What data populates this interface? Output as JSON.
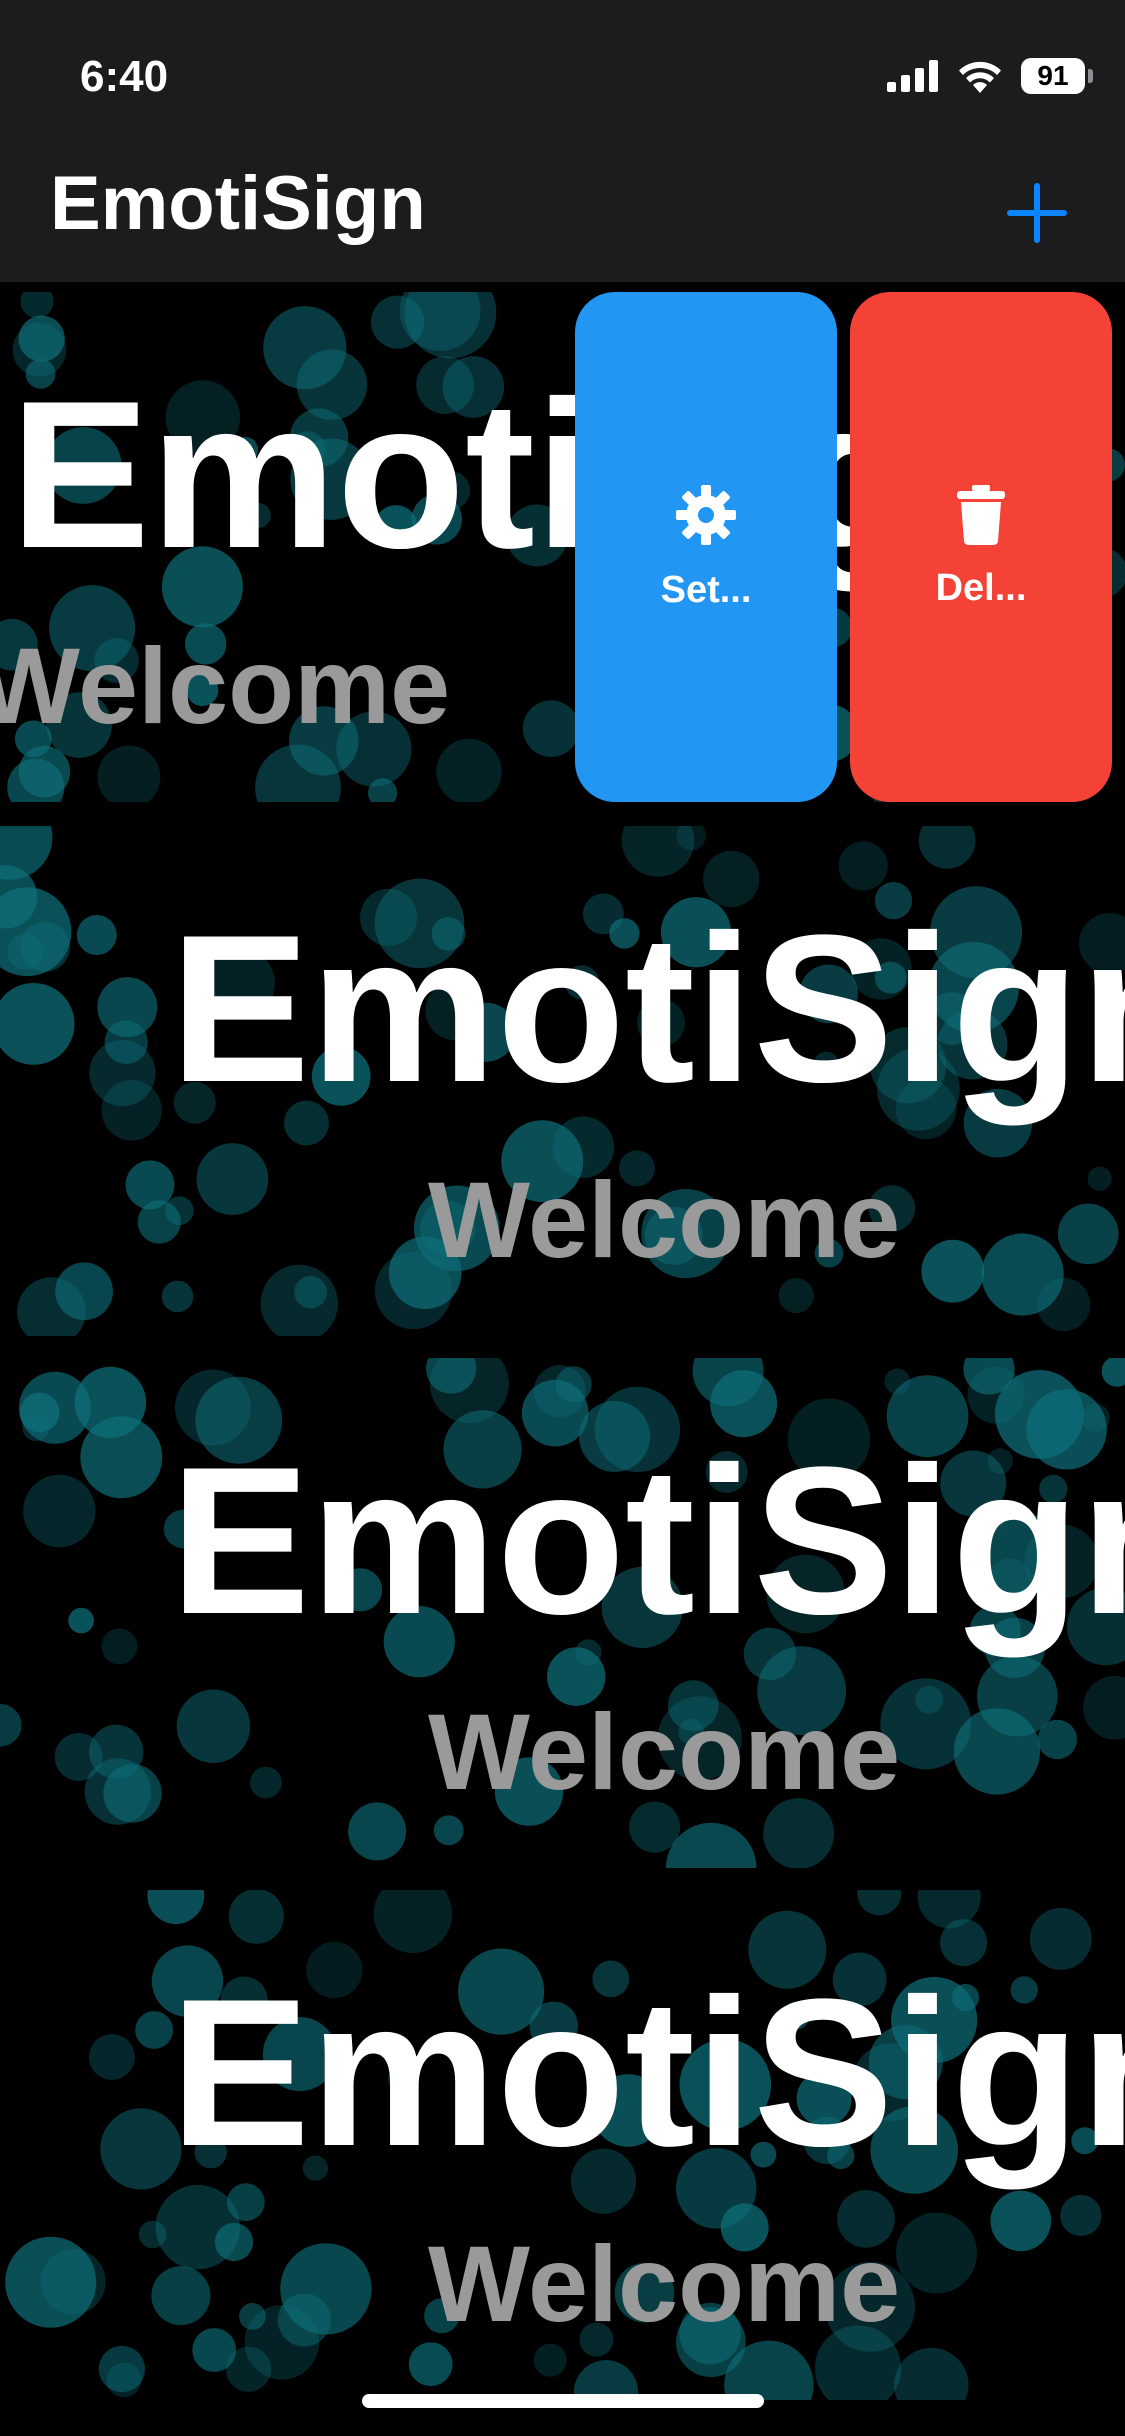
{
  "status_bar": {
    "time": "6:40",
    "battery": "91",
    "signal_icon": "cellular-signal-icon",
    "wifi_icon": "wifi-icon"
  },
  "nav": {
    "title": "EmotiSign",
    "add_icon": "plus-icon",
    "accent_color": "#0a84ff"
  },
  "signs": [
    {
      "title": "EmotiSign",
      "subtitle": "Welcome"
    },
    {
      "title": "EmotiSign",
      "subtitle": "Welcome"
    },
    {
      "title": "EmotiSign",
      "subtitle": "Welcome"
    },
    {
      "title": "EmotiSign",
      "subtitle": "Welcome"
    }
  ],
  "swipe_actions": {
    "settings": {
      "label": "Set...",
      "icon": "gear-icon",
      "color": "#2196f3"
    },
    "delete": {
      "label": "Del...",
      "icon": "trash-icon",
      "color": "#f44336"
    }
  },
  "colors": {
    "background": "#000000",
    "bubble": "#0e6f7a",
    "subtitle": "#9a9a9a"
  }
}
